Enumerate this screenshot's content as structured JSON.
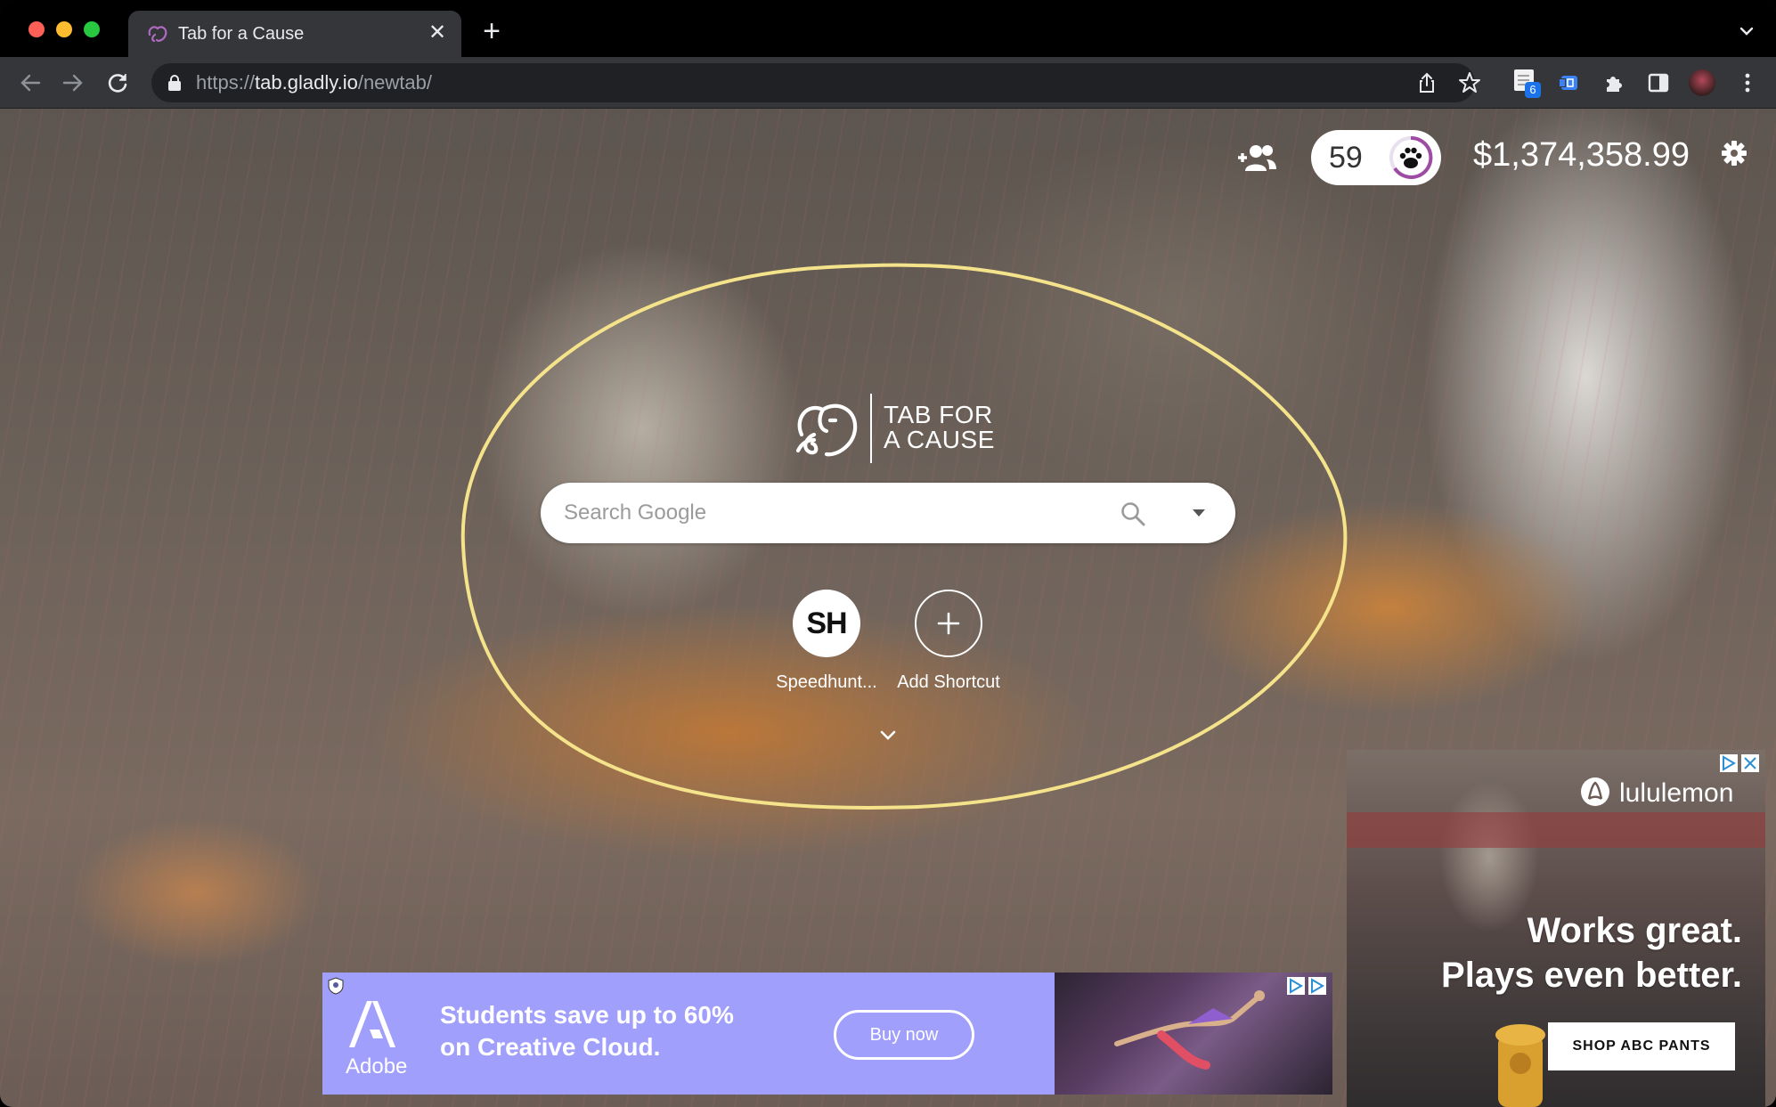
{
  "browser": {
    "tab": {
      "title": "Tab for a Cause",
      "close": "✕"
    },
    "new_tab": "+",
    "url": {
      "scheme": "https://",
      "host": "tab.gladly.io",
      "path": "/newtab/"
    },
    "extension_badge": "6"
  },
  "header": {
    "hearts_count": "59",
    "money_raised": "$1,374,358.99"
  },
  "logo": {
    "line1": "TAB FOR",
    "line2": "A CAUSE"
  },
  "search": {
    "placeholder": "Search Google"
  },
  "shortcuts": [
    {
      "initials": "SH",
      "label": "Speedhunt..."
    },
    {
      "icon": "+",
      "label": "Add Shortcut"
    }
  ],
  "ads": {
    "bottom": {
      "brand": "Adobe",
      "headline": "Students save up to 60% on Creative Cloud.",
      "cta": "Buy now",
      "colors": {
        "background": "#a09ffb"
      }
    },
    "side": {
      "brand": "lululemon",
      "headline_line1": "Works great.",
      "headline_line2": "Plays even better.",
      "cta": "SHOP ABC PANTS"
    }
  },
  "colors": {
    "annotation": "#f4e38a",
    "tab_accent": "#9d4ba3",
    "tabstrip": "#000000",
    "toolbar": "#35363a"
  }
}
